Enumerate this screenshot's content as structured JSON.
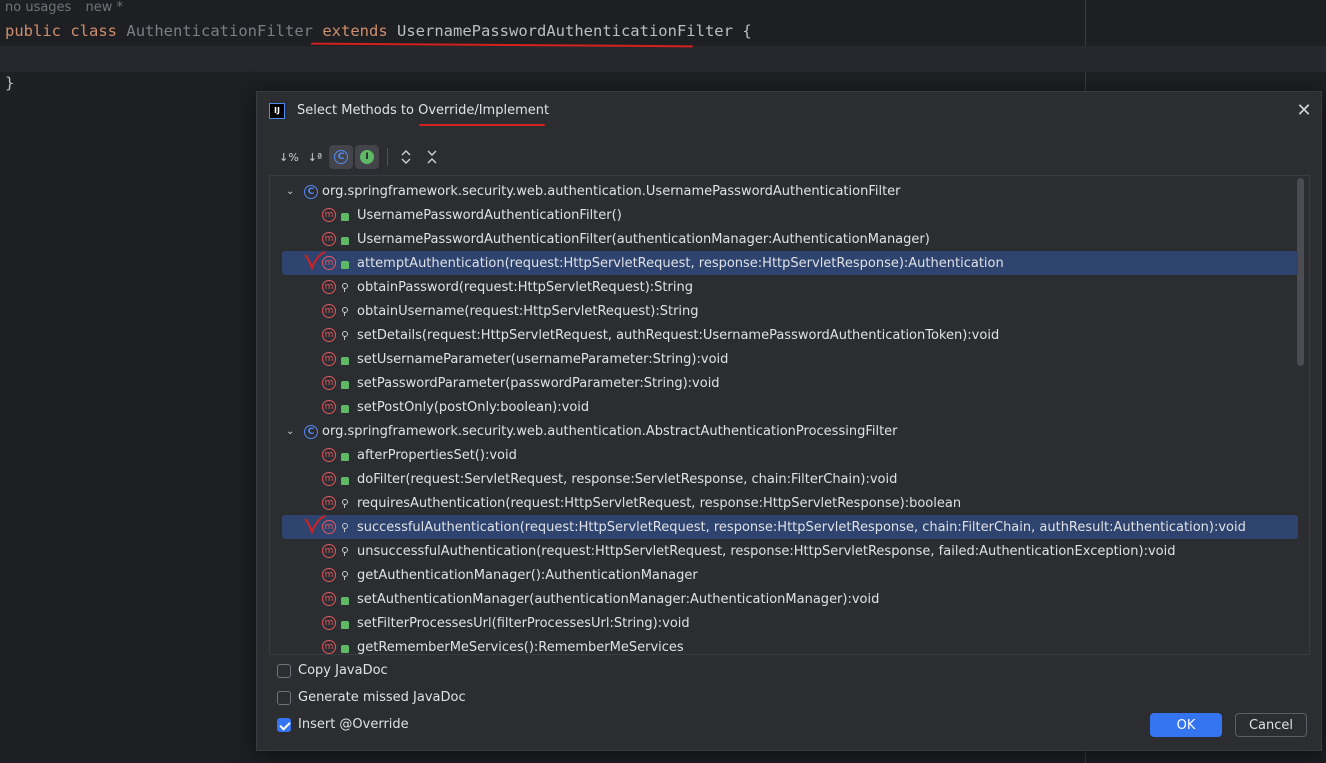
{
  "editor": {
    "hint_usages": "no usages",
    "hint_new": "new *",
    "line1": {
      "kw_public": "public",
      "kw_class": "class",
      "class_name": "AuthenticationFilter",
      "kw_extends": "extends",
      "super_class": "UsernamePasswordAuthenticationFilter",
      "brace_open": "{"
    },
    "line3": "}"
  },
  "dialog": {
    "title_prefix": "Select Methods to ",
    "title_highlight": "Override/Implement",
    "close_label": "✕",
    "app_icon": "IJ",
    "toolbar": [
      {
        "icon": "sort-by-visibility-icon",
        "label": "↓%"
      },
      {
        "icon": "sort-alphabetically-icon",
        "label": "↓ª"
      },
      {
        "icon": "show-classes-icon",
        "label": "C"
      },
      {
        "icon": "show-interfaces-icon",
        "label": "I"
      },
      {
        "icon": "expand-all-icon",
        "label": "⌃⌄"
      },
      {
        "icon": "collapse-all-icon",
        "label": "⌄⌃"
      }
    ],
    "groups": [
      {
        "name": "org.springframework.security.web.authentication.UsernamePasswordAuthenticationFilter",
        "methods": [
          {
            "sig": "UsernamePasswordAuthenticationFilter()",
            "access": "public"
          },
          {
            "sig": "UsernamePasswordAuthenticationFilter(authenticationManager:AuthenticationManager)",
            "access": "public"
          },
          {
            "sig": "attemptAuthentication(request:HttpServletRequest, response:HttpServletResponse):Authentication",
            "access": "public",
            "selected": true
          },
          {
            "sig": "obtainPassword(request:HttpServletRequest):String",
            "access": "protected"
          },
          {
            "sig": "obtainUsername(request:HttpServletRequest):String",
            "access": "protected"
          },
          {
            "sig": "setDetails(request:HttpServletRequest, authRequest:UsernamePasswordAuthenticationToken):void",
            "access": "protected"
          },
          {
            "sig": "setUsernameParameter(usernameParameter:String):void",
            "access": "public"
          },
          {
            "sig": "setPasswordParameter(passwordParameter:String):void",
            "access": "public"
          },
          {
            "sig": "setPostOnly(postOnly:boolean):void",
            "access": "public"
          }
        ]
      },
      {
        "name": "org.springframework.security.web.authentication.AbstractAuthenticationProcessingFilter",
        "methods": [
          {
            "sig": "afterPropertiesSet():void",
            "access": "public"
          },
          {
            "sig": "doFilter(request:ServletRequest, response:ServletResponse, chain:FilterChain):void",
            "access": "public"
          },
          {
            "sig": "requiresAuthentication(request:HttpServletRequest, response:HttpServletResponse):boolean",
            "access": "protected"
          },
          {
            "sig": "successfulAuthentication(request:HttpServletRequest, response:HttpServletResponse, chain:FilterChain, authResult:Authentication):void",
            "access": "protected",
            "selected": true
          },
          {
            "sig": "unsuccessfulAuthentication(request:HttpServletRequest, response:HttpServletResponse, failed:AuthenticationException):void",
            "access": "protected"
          },
          {
            "sig": "getAuthenticationManager():AuthenticationManager",
            "access": "protected"
          },
          {
            "sig": "setAuthenticationManager(authenticationManager:AuthenticationManager):void",
            "access": "public"
          },
          {
            "sig": "setFilterProcessesUrl(filterProcessesUrl:String):void",
            "access": "public"
          },
          {
            "sig": "getRememberMeServices():RememberMeServices",
            "access": "public"
          }
        ]
      }
    ],
    "options": {
      "copy_javadoc": {
        "label": "Copy JavaDoc",
        "checked": false
      },
      "generate_missed_javadoc": {
        "label": "Generate missed JavaDoc",
        "checked": false
      },
      "insert_override": {
        "label": "Insert @Override",
        "checked": true
      }
    },
    "ok_label": "OK",
    "cancel_label": "Cancel"
  },
  "colors": {
    "accent": "#3574f0",
    "selection": "#2e436e",
    "annotation_red": "#d4201f",
    "method_icon": "#e15a60",
    "public_icon": "#5fb865"
  }
}
